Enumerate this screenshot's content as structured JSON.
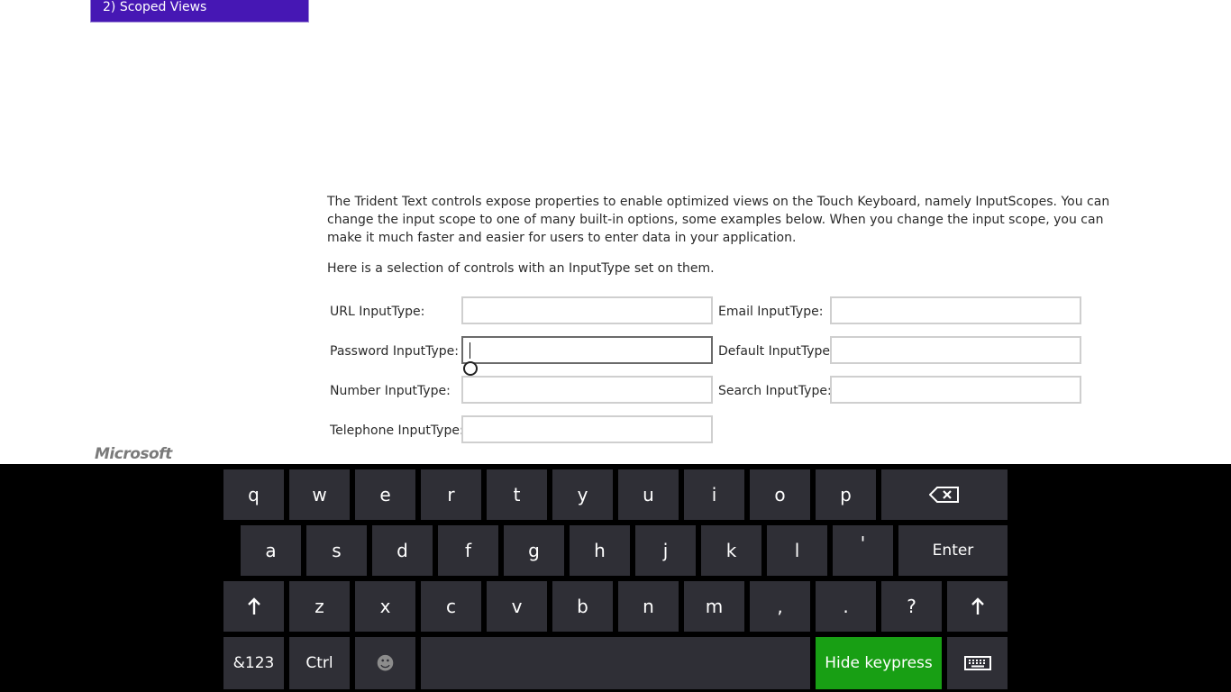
{
  "scenario": {
    "label": "2) Scoped Views"
  },
  "description": "The Trident Text controls expose properties to enable optimized views on the Touch Keyboard, namely InputScopes. You can change the input scope to one of many built-in options, some examples below. When you change the input scope, you can make it much faster and easier for users to enter data in your application.",
  "subtitle": "Here is a selection of controls with an InputType set on them.",
  "fields": {
    "url": {
      "label": "URL InputType:",
      "value": ""
    },
    "email": {
      "label": "Email InputType:",
      "value": ""
    },
    "password": {
      "label": "Password InputType:",
      "value": ""
    },
    "default": {
      "label": "Default InputType:",
      "value": ""
    },
    "number": {
      "label": "Number InputType:",
      "value": ""
    },
    "search": {
      "label": "Search InputType:",
      "value": ""
    },
    "telephone": {
      "label": "Telephone InputType:",
      "value": ""
    }
  },
  "logo": "Microsoft",
  "keyboard": {
    "row1": [
      "q",
      "w",
      "e",
      "r",
      "t",
      "y",
      "u",
      "i",
      "o",
      "p"
    ],
    "row2": [
      "a",
      "s",
      "d",
      "f",
      "g",
      "h",
      "j",
      "k",
      "l",
      "'"
    ],
    "row3": [
      "z",
      "x",
      "c",
      "v",
      "b",
      "n",
      "m",
      ",",
      ".",
      "?"
    ],
    "enter": "Enter",
    "symbols": "&123",
    "ctrl": "Ctrl",
    "emoji": "☻",
    "hide": "Hide keypress",
    "icons": {
      "backspace": "backspace-icon",
      "shift": "shift-arrow-icon",
      "keyboard": "keyboard-icon"
    }
  },
  "colors": {
    "accent": "#4617b4",
    "hide_key": "#189f14",
    "key": "#2f2f36",
    "keyboard_bg": "#000000"
  }
}
